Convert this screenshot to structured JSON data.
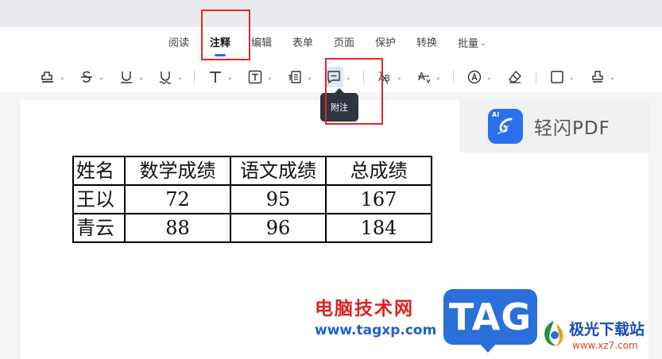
{
  "menu": {
    "items": [
      {
        "label": "阅读"
      },
      {
        "label": "注释",
        "active": true
      },
      {
        "label": "编辑"
      },
      {
        "label": "表单"
      },
      {
        "label": "页面"
      },
      {
        "label": "保护"
      },
      {
        "label": "转换"
      },
      {
        "label": "批量",
        "dropdown": true
      }
    ]
  },
  "toolbar": {
    "tools": [
      {
        "icon": "highlight-icon"
      },
      {
        "icon": "strikethrough-icon"
      },
      {
        "icon": "underline-icon"
      },
      {
        "icon": "wavy-underline-icon"
      },
      {
        "icon": "text-icon"
      },
      {
        "icon": "textbox-icon"
      },
      {
        "icon": "callout-icon"
      },
      {
        "icon": "note-icon",
        "selected": true
      },
      {
        "icon": "replace-text-icon",
        "glyph": "AB"
      },
      {
        "icon": "insert-text-icon",
        "glyph": "A"
      },
      {
        "icon": "shape-icon"
      },
      {
        "icon": "eraser-icon"
      },
      {
        "icon": "rectangle-icon"
      },
      {
        "icon": "stamp-icon"
      }
    ],
    "tooltip": "附注"
  },
  "brand": {
    "badge": "AI",
    "name": "轻闪PDF"
  },
  "table": {
    "headers": [
      "姓名",
      "数学成绩",
      "语文成绩",
      "总成绩"
    ],
    "rows": [
      [
        "王以",
        "72",
        "95",
        "167"
      ],
      [
        "青云",
        "88",
        "96",
        "184"
      ]
    ]
  },
  "watermarks": {
    "site_cn": "电脑技术网",
    "site_url": "www.tagxp.com",
    "tag": "TAG",
    "jg_name": "极光下载站",
    "jg_url": "www.xz7.com"
  },
  "colors": {
    "accent": "#2b6cf0",
    "highlight_box": "#e0262a",
    "tooltip_bg": "#2f3540"
  }
}
